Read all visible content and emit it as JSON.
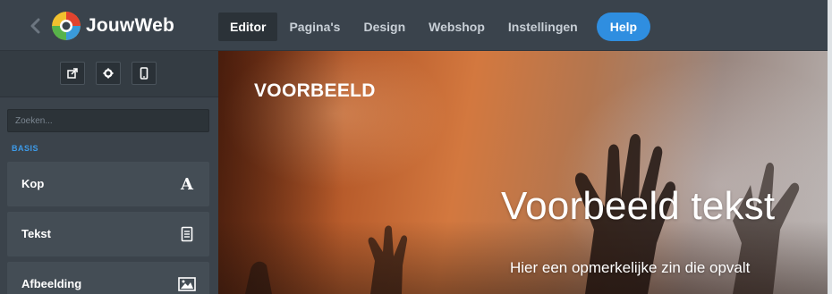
{
  "header": {
    "brand": "JouwWeb",
    "nav": [
      {
        "label": "Editor",
        "active": true
      },
      {
        "label": "Pagina's",
        "active": false
      },
      {
        "label": "Design",
        "active": false
      },
      {
        "label": "Webshop",
        "active": false
      },
      {
        "label": "Instellingen",
        "active": false
      }
    ],
    "help_label": "Help",
    "help_color": "#2f8ee0"
  },
  "sidebar": {
    "tools": [
      {
        "icon": "external-link-icon"
      },
      {
        "icon": "gear-icon"
      },
      {
        "icon": "mobile-icon"
      }
    ],
    "search": {
      "placeholder": "Zoeken...",
      "value": ""
    },
    "section_label": "BASIS",
    "elements": [
      {
        "label": "Kop",
        "icon": "heading-icon"
      },
      {
        "label": "Tekst",
        "icon": "text-document-icon"
      },
      {
        "label": "Afbeelding",
        "icon": "image-icon"
      }
    ]
  },
  "canvas": {
    "site_title": "VOORBEELD",
    "hero_title": "Voorbeeld tekst",
    "hero_subtitle": "Hier een opmerkelijke zin die opvalt"
  }
}
